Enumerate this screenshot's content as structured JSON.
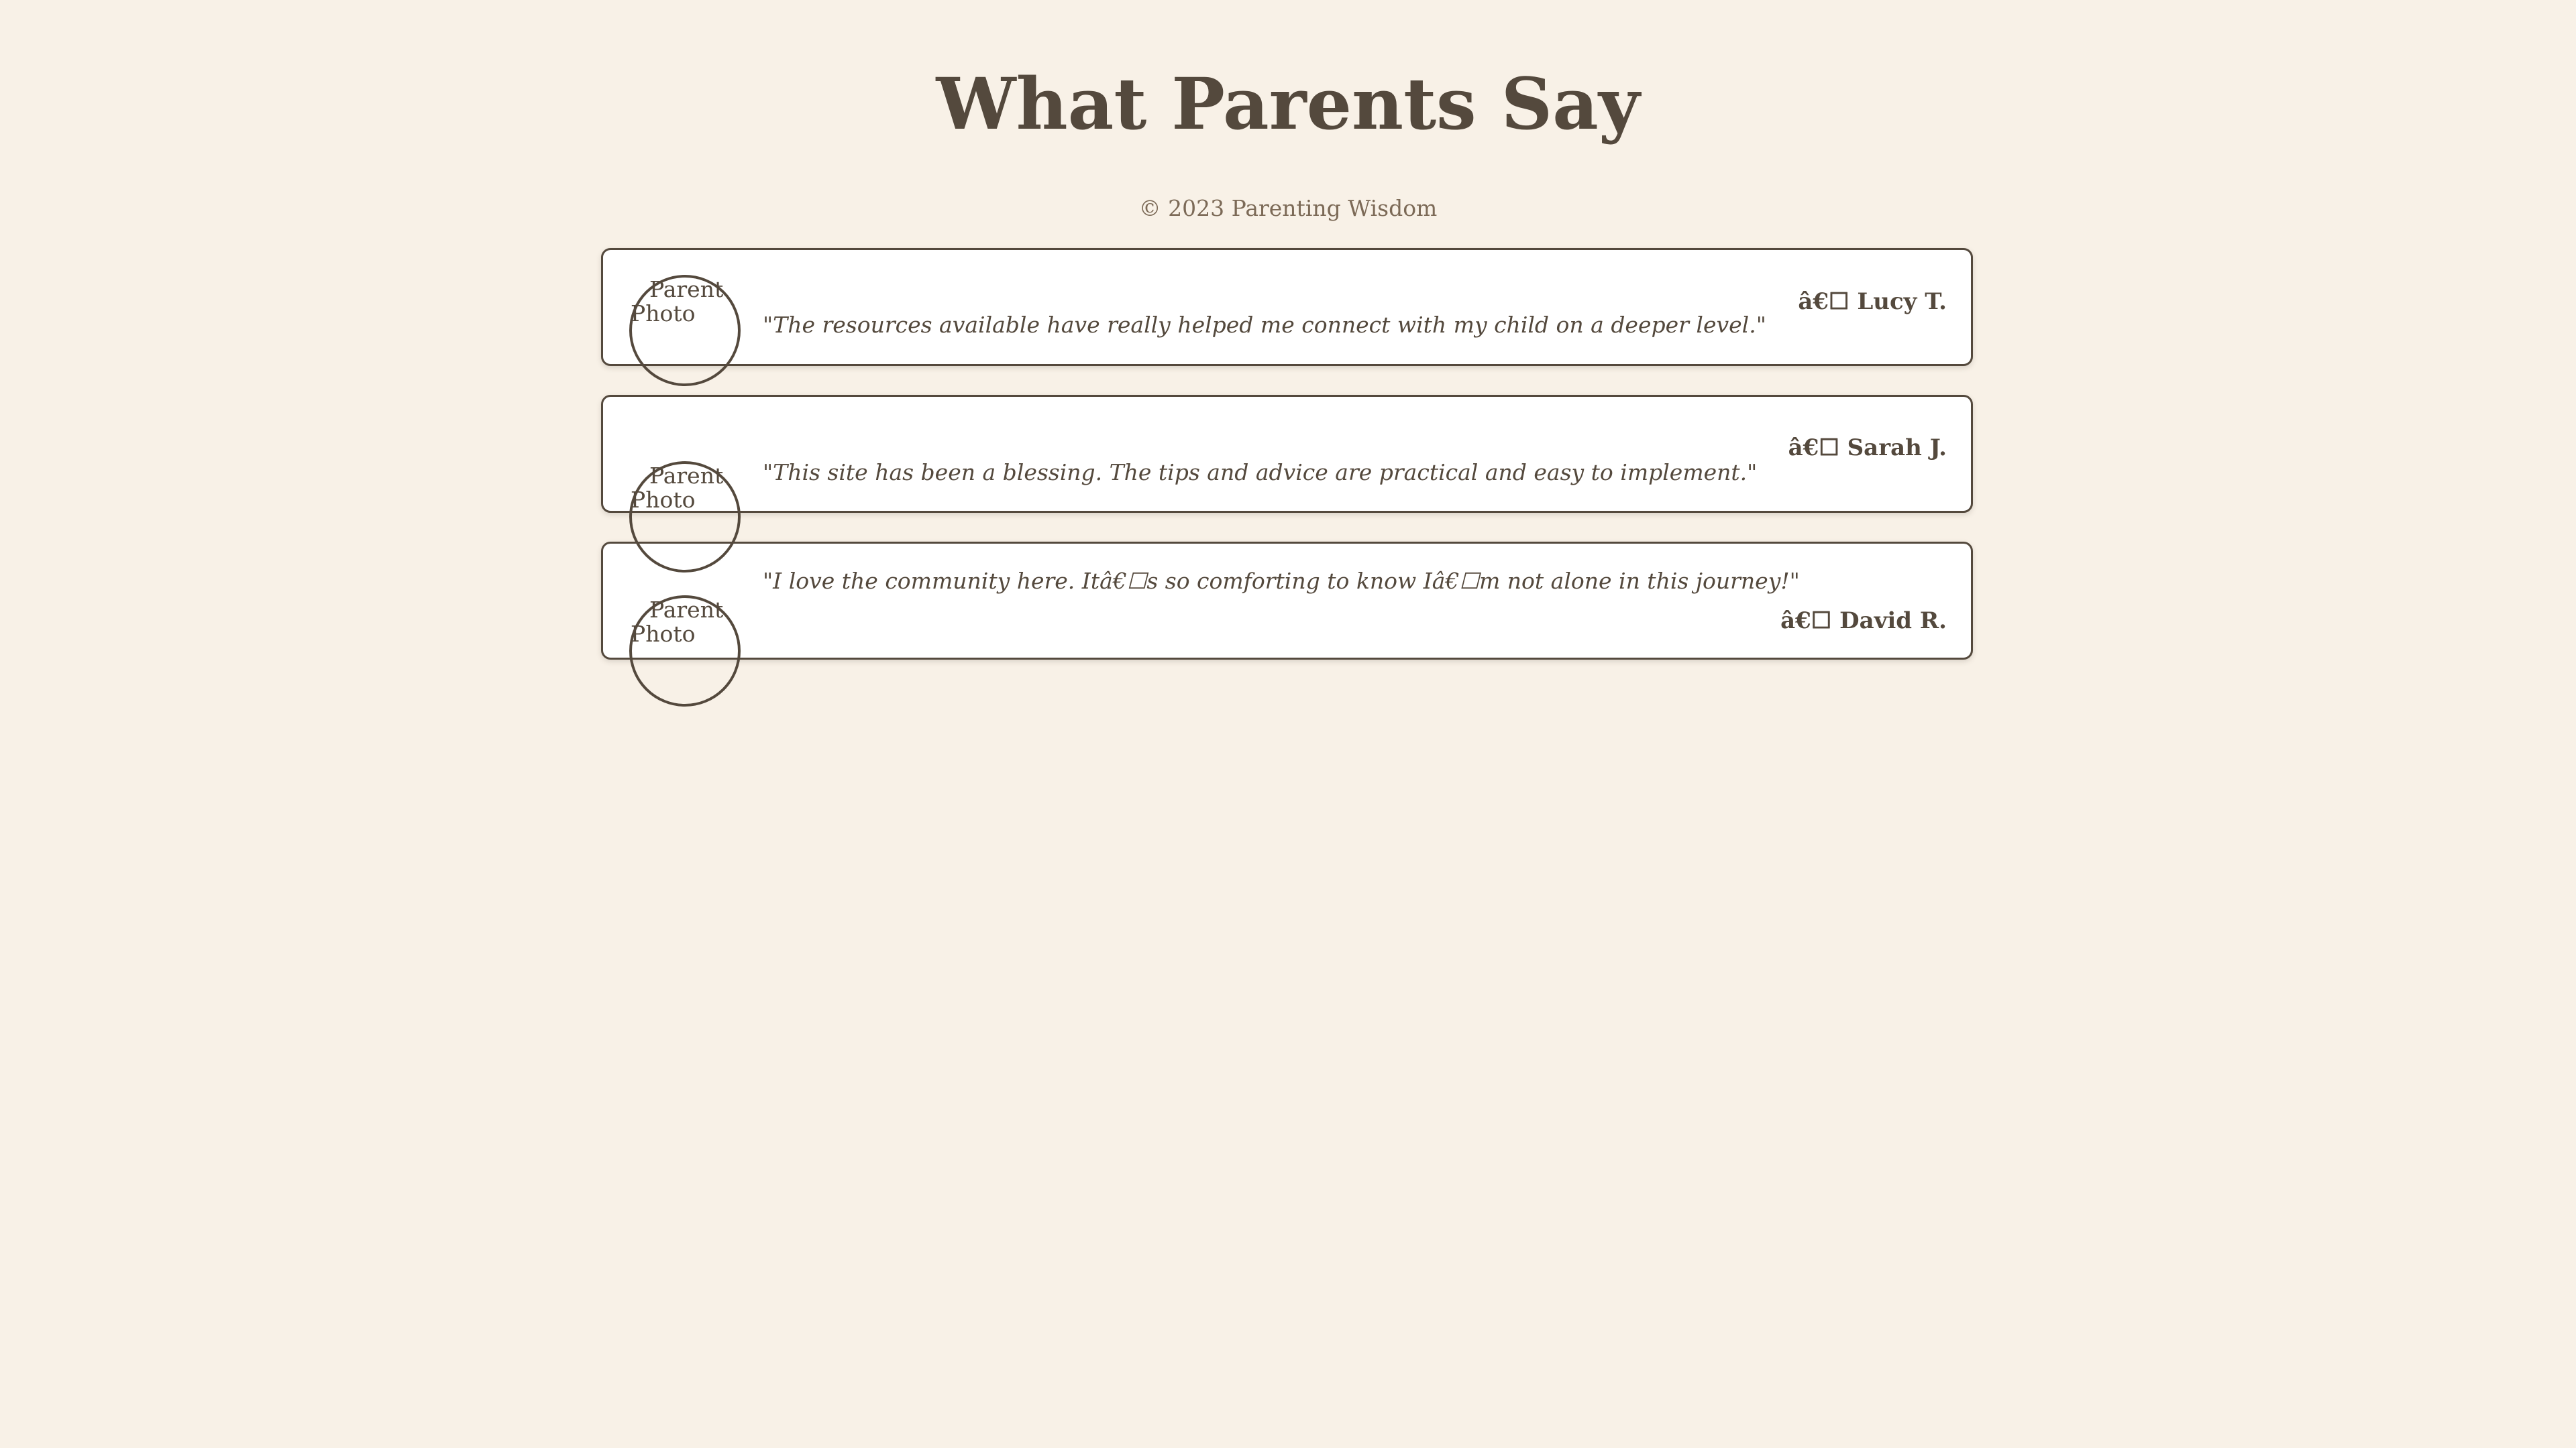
{
  "header": {
    "title": "What Parents Say",
    "copyright": "© 2023 Parenting Wisdom"
  },
  "testimonials": [
    {
      "photo_alt": "Parent Photo",
      "quote": "\"The resources available have really helped me connect with my child on a deeper level.\"",
      "author": "â€☐ Lucy T."
    },
    {
      "photo_alt": "Parent Photo",
      "quote": "\"This site has been a blessing. The tips and advice are practical and easy to implement.\"",
      "author": "â€☐ Sarah J."
    },
    {
      "photo_alt": "Parent Photo",
      "quote": "\"I love the community here. Itâ€☐s so comforting to know Iâ€☐m not alone in this journey!\"",
      "author": "â€☐ David R."
    }
  ],
  "colors": {
    "background": "#f8f1e7",
    "text": "#54493d",
    "card": "#ffffff",
    "muted": "#7c6a57"
  }
}
